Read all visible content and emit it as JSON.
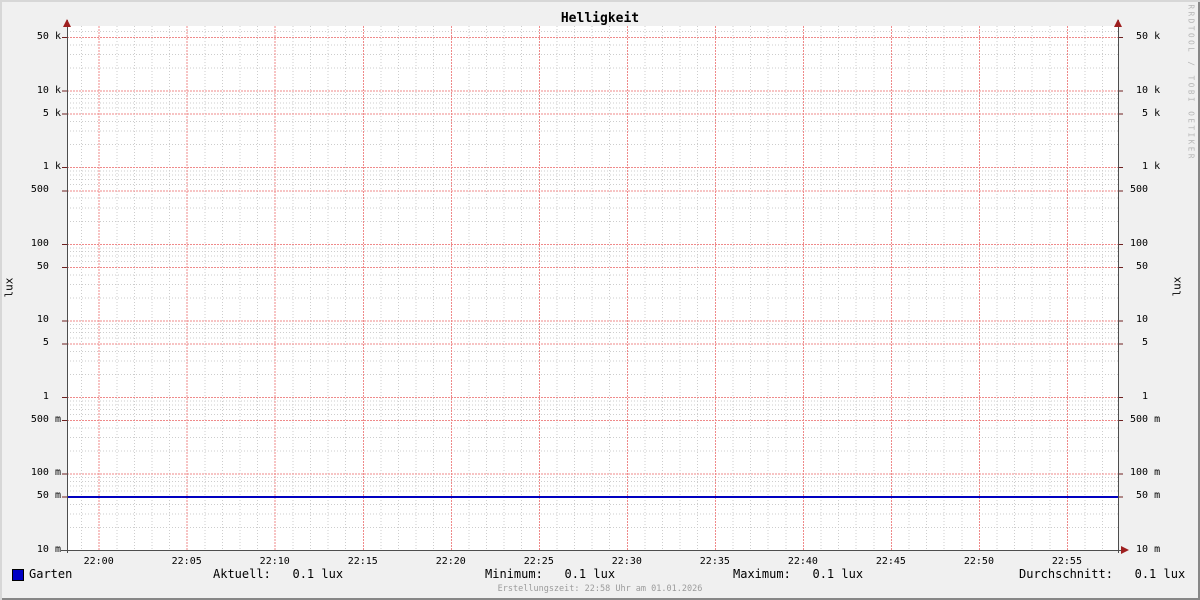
{
  "chart_data": {
    "type": "line",
    "title": "Helligkeit",
    "ylabel_left": "lux",
    "ylabel_right": "lux",
    "y_scale": "log",
    "ylim": [
      0.01,
      70000
    ],
    "y_labeled_ticks": [
      {
        "v": 50000,
        "label": "50 k"
      },
      {
        "v": 10000,
        "label": "10 k"
      },
      {
        "v": 5000,
        "label": "5 k"
      },
      {
        "v": 1000,
        "label": "1 k"
      },
      {
        "v": 500,
        "label": "500"
      },
      {
        "v": 100,
        "label": "100"
      },
      {
        "v": 50,
        "label": "50"
      },
      {
        "v": 10,
        "label": "10"
      },
      {
        "v": 5,
        "label": "5"
      },
      {
        "v": 1,
        "label": "1"
      },
      {
        "v": 0.5,
        "label": "500 m"
      },
      {
        "v": 0.1,
        "label": "100 m"
      },
      {
        "v": 0.05,
        "label": "50 m"
      },
      {
        "v": 0.01,
        "label": "10 m"
      }
    ],
    "y_major_grid": [
      0.05,
      0.1,
      0.5,
      1,
      5,
      10,
      50,
      100,
      500,
      1000,
      5000,
      10000,
      50000
    ],
    "y_minor_multiples": [
      2,
      3,
      4,
      6,
      7,
      8,
      9
    ],
    "x_axis": {
      "t0_min": -1.8,
      "t1_min": 57.9,
      "minor_step_min": 1,
      "major_step_min": 5,
      "major_ticks": [
        {
          "t_min": 0,
          "label": "22:00"
        },
        {
          "t_min": 5,
          "label": "22:05"
        },
        {
          "t_min": 10,
          "label": "22:10"
        },
        {
          "t_min": 15,
          "label": "22:15"
        },
        {
          "t_min": 20,
          "label": "22:20"
        },
        {
          "t_min": 25,
          "label": "22:25"
        },
        {
          "t_min": 30,
          "label": "22:30"
        },
        {
          "t_min": 35,
          "label": "22:35"
        },
        {
          "t_min": 40,
          "label": "22:40"
        },
        {
          "t_min": 45,
          "label": "22:45"
        },
        {
          "t_min": 50,
          "label": "22:50"
        },
        {
          "t_min": 55,
          "label": "22:55"
        }
      ]
    },
    "series": [
      {
        "name": "Garten",
        "unit": "lux",
        "points": [
          {
            "t_min": -1.8,
            "lux": 0.05
          },
          {
            "t_min": 57.9,
            "lux": 0.05
          }
        ]
      }
    ],
    "legend": {
      "series_label": "Garten",
      "stats": [
        {
          "key": "aktuell",
          "label": "Aktuell:",
          "value": "0.1 lux"
        },
        {
          "key": "minimum",
          "label": "Minimum:",
          "value": "0.1 lux"
        },
        {
          "key": "maximum",
          "label": "Maximum:",
          "value": "0.1 lux"
        },
        {
          "key": "durchschnitt",
          "label": "Durchschnitt:",
          "value": "0.1 lux"
        }
      ]
    },
    "footer_note": "Erstellungszeit: 22:58 Uhr am 01.01.2026",
    "watermark": "RRDTOOL / TOBI OETIKER",
    "colors": {
      "background": "#f0f0f0",
      "canvas": "#ffffff",
      "major_grid": "#ef8a8a",
      "minor_grid": "#cdcdcd",
      "axis": "#4d4d4d",
      "arrow": "#9e1f1f",
      "tick": "#6e2020",
      "series_line": "#0000c0",
      "legend_swatch": "#0000c4"
    }
  }
}
